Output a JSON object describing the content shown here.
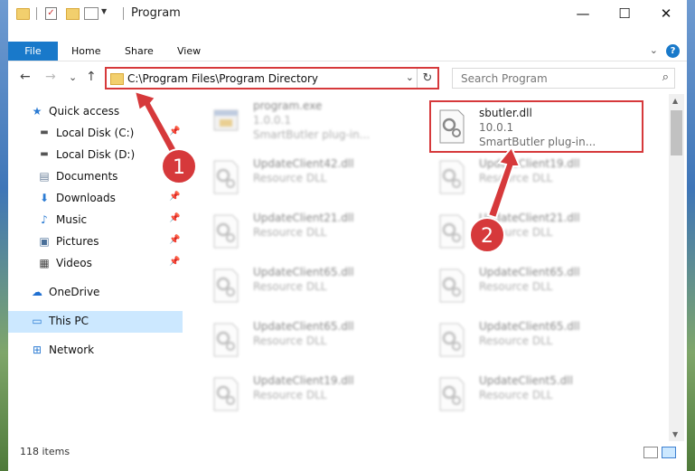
{
  "window": {
    "title": "Program",
    "minimize": "—",
    "maximize": "☐",
    "close": "✕"
  },
  "ribbon": {
    "tabs": [
      {
        "label": "File"
      },
      {
        "label": "Home"
      },
      {
        "label": "Share"
      },
      {
        "label": "View"
      }
    ],
    "expand": "⌄",
    "help": "?"
  },
  "addressbar": {
    "path": "C:\\Program Files\\Program Directory",
    "back": "←",
    "forward": "→",
    "recent": "⌄",
    "up": "↑",
    "dropdown": "⌄",
    "refresh": "↻"
  },
  "search": {
    "placeholder": "Search Program",
    "icon": "⌕"
  },
  "sidebar": {
    "items": [
      {
        "label": "Quick access",
        "icon": "star-icon"
      },
      {
        "label": "Local Disk (C:)",
        "icon": "drive-icon"
      },
      {
        "label": "Local Disk (D:)",
        "icon": "drive-icon"
      },
      {
        "label": "Documents",
        "icon": "documents-icon"
      },
      {
        "label": "Downloads",
        "icon": "download-icon"
      },
      {
        "label": "Music",
        "icon": "music-icon"
      },
      {
        "label": "Pictures",
        "icon": "pictures-icon"
      },
      {
        "label": "Videos",
        "icon": "videos-icon"
      },
      {
        "label": "OneDrive",
        "icon": "cloud-icon"
      },
      {
        "label": "This PC",
        "icon": "computer-icon"
      },
      {
        "label": "Network",
        "icon": "network-icon"
      }
    ],
    "selected": "This PC"
  },
  "files": [
    {
      "name": "program.exe",
      "line1": "1.0.0.1",
      "line2": "SmartButler plug-in..."
    },
    {
      "name": "sbutler.dll",
      "line1": "10.0.1",
      "line2": "SmartButler plug-in..."
    },
    {
      "name": "UpdateClient42.dll",
      "line1": "Resource DLL"
    },
    {
      "name": "UpdateClient19.dll",
      "line1": "Resource DLL"
    },
    {
      "name": "UpdateClient21.dll",
      "line1": "Resource DLL"
    },
    {
      "name": "UpdateClient21.dll",
      "line1": "Resource DLL"
    },
    {
      "name": "UpdateClient65.dll",
      "line1": "Resource DLL"
    },
    {
      "name": "UpdateClient65.dll",
      "line1": "Resource DLL"
    },
    {
      "name": "UpdateClient65.dll",
      "line1": "Resource DLL"
    },
    {
      "name": "UpdateClient65.dll",
      "line1": "Resource DLL"
    },
    {
      "name": "UpdateClient19.dll",
      "line1": "Resource DLL"
    },
    {
      "name": "UpdateClient5.dll",
      "line1": "Resource DLL"
    }
  ],
  "status": {
    "count": "118 items"
  },
  "annotations": {
    "step1": "1",
    "step2": "2",
    "color": "#d6393b"
  }
}
